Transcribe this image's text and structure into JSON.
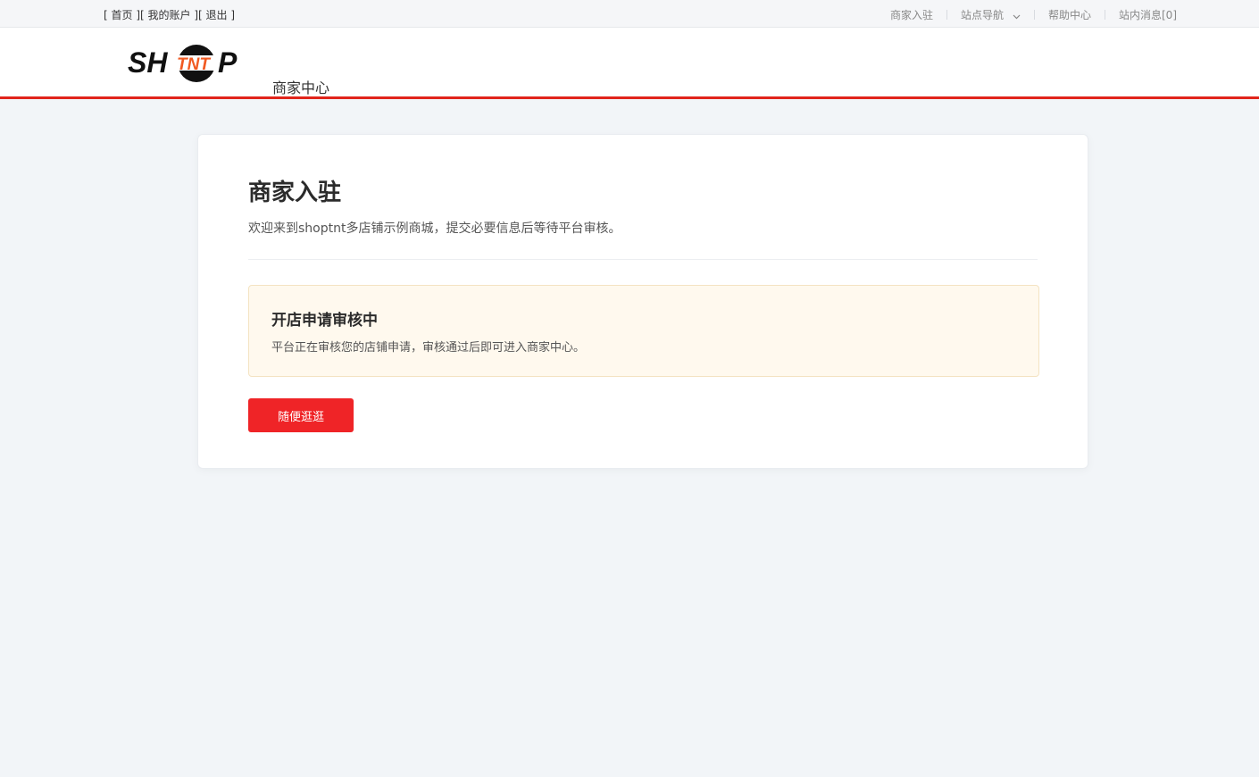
{
  "topbar": {
    "left": {
      "bracket_open": "[ ",
      "home": "首页",
      "mid1": " ][ ",
      "account": "我的账户",
      "mid2": " ][ ",
      "logout": "退出",
      "bracket_close": " ]"
    },
    "right": {
      "merchant_join": "商家入驻",
      "site_nav": "站点导航",
      "help_center": "帮助中心",
      "messages": "站内消息[0]"
    }
  },
  "header": {
    "logo": {
      "left_text": "SH",
      "middle_text": "TNT",
      "right_text": "P"
    },
    "title": "商家中心"
  },
  "card": {
    "title": "商家入驻",
    "subtitle": "欢迎来到shoptnt多店铺示例商城，提交必要信息后等待平台审核。",
    "notice": {
      "title": "开店申请审核中",
      "text": "平台正在审核您的店铺申请，审核通过后即可进入商家中心。"
    },
    "button_label": "随便逛逛"
  },
  "colors": {
    "accent": "#e1251b",
    "button": "#ef2427",
    "notice_bg": "#fff9ee",
    "logo_orange": "#f15a22"
  }
}
